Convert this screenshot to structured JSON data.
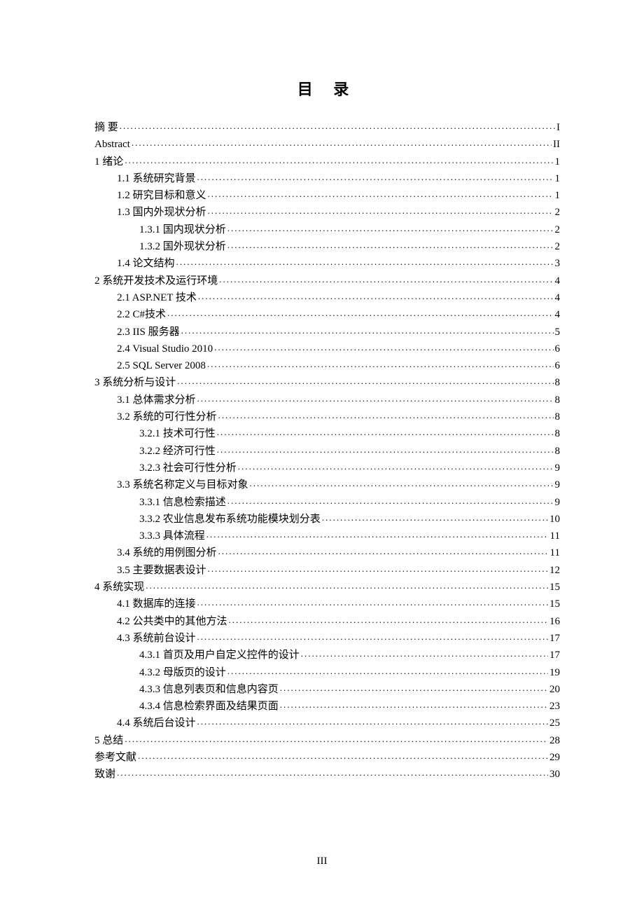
{
  "title": "目 录",
  "page_number": "III",
  "toc": [
    {
      "label": "摘 要",
      "page": "I",
      "indent": 0
    },
    {
      "label": "Abstract",
      "page": "II",
      "indent": 0
    },
    {
      "label": "1  绪论",
      "page": "1",
      "indent": 0
    },
    {
      "label": "1.1  系统研究背景",
      "page": "1",
      "indent": 1
    },
    {
      "label": "1.2  研究目标和意义",
      "page": "1",
      "indent": 1
    },
    {
      "label": "1.3  国内外现状分析",
      "page": "2",
      "indent": 1
    },
    {
      "label": "1.3.1  国内现状分析",
      "page": "2",
      "indent": 2
    },
    {
      "label": "1.3.2  国外现状分析",
      "page": "2",
      "indent": 2
    },
    {
      "label": "1.4  论文结构",
      "page": "3",
      "indent": 1
    },
    {
      "label": "2 系统开发技术及运行环境",
      "page": "4",
      "indent": 0
    },
    {
      "label": "2.1 ASP.NET 技术",
      "page": "4",
      "indent": 1
    },
    {
      "label": "2.2 C#技术",
      "page": "4",
      "indent": 1
    },
    {
      "label": "2.3 IIS 服务器",
      "page": "5",
      "indent": 1
    },
    {
      "label": "2.4 Visual Studio 2010",
      "page": "6",
      "indent": 1
    },
    {
      "label": "2.5 SQL Server 2008",
      "page": "6",
      "indent": 1
    },
    {
      "label": "3 系统分析与设计",
      "page": "8",
      "indent": 0
    },
    {
      "label": "3.1 总体需求分析",
      "page": "8",
      "indent": 1
    },
    {
      "label": "3.2  系统的可行性分析",
      "page": "8",
      "indent": 1
    },
    {
      "label": "3.2.1 技术可行性",
      "page": "8",
      "indent": 2
    },
    {
      "label": "3.2.2 经济可行性",
      "page": "8",
      "indent": 2
    },
    {
      "label": "3.2.3 社会可行性分析",
      "page": "9",
      "indent": 2
    },
    {
      "label": "3.3 系统名称定义与目标对象",
      "page": "9",
      "indent": 1
    },
    {
      "label": "3.3.1 信息检索描述",
      "page": "9",
      "indent": 2
    },
    {
      "label": "3.3.2 农业信息发布系统功能模块划分表",
      "page": "10",
      "indent": 2
    },
    {
      "label": "3.3.3 具体流程",
      "page": "11",
      "indent": 2
    },
    {
      "label": "3.4  系统的用例图分析",
      "page": "11",
      "indent": 1
    },
    {
      "label": "3.5 主要数据表设计",
      "page": "12",
      "indent": 1
    },
    {
      "label": "4  系统实现",
      "page": "15",
      "indent": 0
    },
    {
      "label": "4.1  数据库的连接",
      "page": "15",
      "indent": 1
    },
    {
      "label": "4.2 公共类中的其他方法",
      "page": "16",
      "indent": 1
    },
    {
      "label": "4.3  系统前台设计",
      "page": "17",
      "indent": 1
    },
    {
      "label": "4.3.1 首页及用户自定义控件的设计",
      "page": "17",
      "indent": 2
    },
    {
      "label": "4.3.2  母版页的设计",
      "page": "19",
      "indent": 2
    },
    {
      "label": "4.3.3  信息列表页和信息内容页",
      "page": "20",
      "indent": 2
    },
    {
      "label": "4.3.4  信息检索界面及结果页面",
      "page": "23",
      "indent": 2
    },
    {
      "label": "4.4  系统后台设计",
      "page": "25",
      "indent": 1
    },
    {
      "label": "5  总结",
      "page": "28",
      "indent": 0
    },
    {
      "label": "参考文献",
      "page": "29",
      "indent": 0
    },
    {
      "label": "致谢",
      "page": "30",
      "indent": 0
    }
  ]
}
